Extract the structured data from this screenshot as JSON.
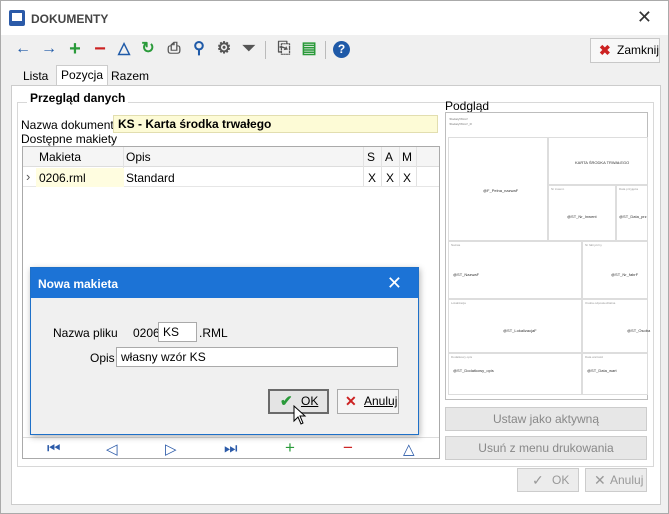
{
  "window": {
    "title": "DOKUMENTY"
  },
  "toolbar": {
    "icons": [
      "arrow-left-icon",
      "arrow-right-icon",
      "add-icon",
      "remove-icon",
      "up-icon",
      "refresh-icon",
      "print-icon",
      "search-icon",
      "settings-icon",
      "filter-icon",
      "copy-icon",
      "export-icon",
      "help-icon"
    ],
    "close_label": "Zamknij"
  },
  "tabs": [
    "Lista",
    "Pozycja",
    "Razem"
  ],
  "main": {
    "section_title": "Przegląd danych",
    "doc_name_label": "Nazwa dokumentu",
    "doc_name_value": "KS - Karta środka trwałego",
    "available_label": "Dostępne makiety",
    "grid": {
      "columns": [
        "Makieta",
        "Opis",
        "S",
        "A",
        "M"
      ],
      "rows": [
        {
          "makieta": "0206.rml",
          "opis": "Standard",
          "s": "X",
          "a": "X",
          "m": "X"
        }
      ]
    },
    "nav": [
      "⏮",
      "◁",
      "▷",
      "⏭",
      "+",
      "−",
      "△"
    ]
  },
  "preview": {
    "label": "Podgląd",
    "header_lines": [
      "!Dodaty!Wzor!",
      "!Dodaty!Wzor!_R"
    ],
    "title": "KARTA ŚRODKA TRWAŁEGO",
    "cells": [
      {
        "small": "",
        "text": "@F_Pelna_nazwaF"
      },
      {
        "small": "Nr inwent.",
        "text": ""
      },
      {
        "small": "Data przyjęcia",
        "text": ""
      },
      {
        "small": "",
        "text": "@ST_Nr_Inwent"
      },
      {
        "small": "",
        "text": "@ST_Data_prz"
      },
      {
        "small": "Nazwa",
        "text": "@ST_NazwaF"
      },
      {
        "small": "Nr fabryczny",
        "text": "@ST_Nr_fabrF"
      },
      {
        "small": "Lokalizacja",
        "text": "@ST_LokalizacjaF"
      },
      {
        "small": "Osoba odpowiedzialna",
        "text": "@ST_Osoba"
      },
      {
        "small": "Dodatkowy opis",
        "text": "@ST_Dodatkowy_opis"
      },
      {
        "small": "Data wartości",
        "text": "@ST_Data_wart"
      }
    ]
  },
  "side_buttons": {
    "set_active": "Ustaw jako aktywną",
    "remove_menu": "Usuń z menu drukowania"
  },
  "footer": {
    "ok": "OK",
    "cancel": "Anuluj"
  },
  "dialog": {
    "title": "Nowa makieta",
    "file_label": "Nazwa pliku",
    "file_prefix": "0206",
    "file_value": "KS",
    "file_suffix": ".RML",
    "desc_label": "Opis",
    "desc_value": "własny wzór KS",
    "ok": "OK",
    "cancel": "Anuluj"
  }
}
